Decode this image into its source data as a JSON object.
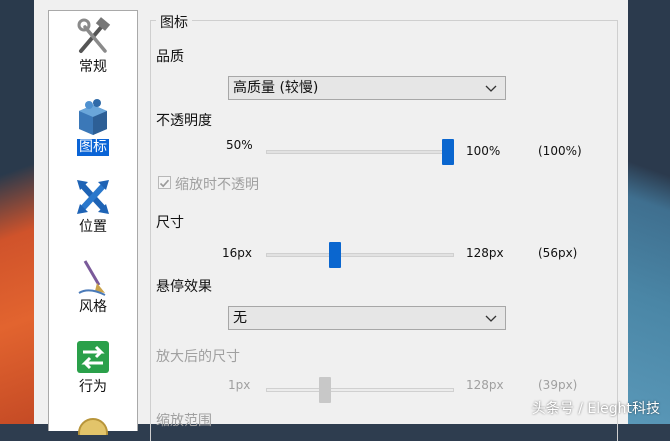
{
  "sidebar": {
    "items": [
      {
        "label": "常规",
        "icon": "tools-icon",
        "selected": false
      },
      {
        "label": "图标",
        "icon": "icon-box-icon",
        "selected": true
      },
      {
        "label": "位置",
        "icon": "arrows-cross-icon",
        "selected": false
      },
      {
        "label": "风格",
        "icon": "brush-icon",
        "selected": false
      },
      {
        "label": "行为",
        "icon": "behavior-arrows-icon",
        "selected": false
      }
    ]
  },
  "panel": {
    "group_title": "图标",
    "quality": {
      "label": "品质",
      "selected": "高质量 (较慢)"
    },
    "opacity": {
      "label": "不透明度",
      "min_label": "50%",
      "max_label": "100%",
      "current_label": "(100%)",
      "value_fraction": 1.0
    },
    "opaque_zoom": {
      "label": "缩放时不透明",
      "checked": true
    },
    "size": {
      "label": "尺寸",
      "min_label": "16px",
      "max_label": "128px",
      "current_label": "(56px)",
      "value_fraction": 0.36
    },
    "hover": {
      "label": "悬停效果",
      "selected": "无"
    },
    "zoomed_size": {
      "label": "放大后的尺寸",
      "min_label": "1px",
      "max_label": "128px",
      "current_label": "(39px)",
      "value_fraction": 0.3
    },
    "zoom_range": {
      "label": "缩放范围"
    }
  },
  "watermark": "头条号 / Eleght科技",
  "colors": {
    "accent": "#0a66cf",
    "selected_bg": "#0a64d6"
  }
}
